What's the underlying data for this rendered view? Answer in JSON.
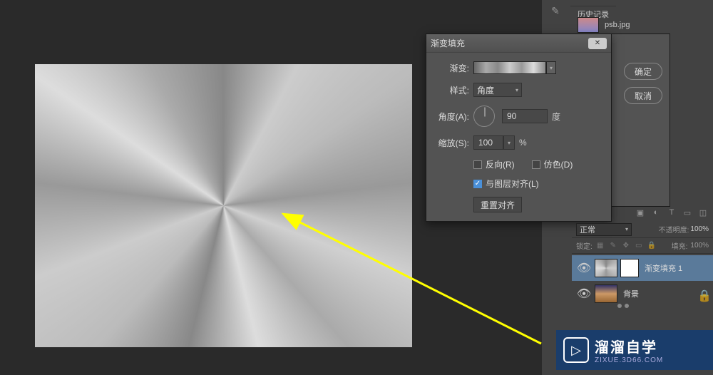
{
  "dialog": {
    "title": "渐变填充",
    "gradient_label": "渐变:",
    "style_label": "样式:",
    "style_value": "角度",
    "angle_label": "角度(A):",
    "angle_value": "90",
    "angle_unit": "度",
    "scale_label": "缩放(S):",
    "scale_value": "100",
    "scale_unit": "%",
    "reverse_label": "反向(R)",
    "dither_label": "仿色(D)",
    "align_label": "与图层对齐(L)",
    "reset_btn": "重置对齐",
    "ok": "确定",
    "cancel": "取消"
  },
  "panels": {
    "history_tab": "历史记录",
    "history_item": "psb.jpg",
    "blend_mode": "正常",
    "opacity_label": "不透明度:",
    "opacity_value": "100%",
    "lock_label": "锁定:",
    "fill_label": "填充:",
    "fill_value": "100%",
    "layer1": "渐变填充 1",
    "layer2": "背景"
  },
  "watermark": {
    "title": "溜溜自学",
    "sub": "ZIXUE.3D66.COM"
  }
}
